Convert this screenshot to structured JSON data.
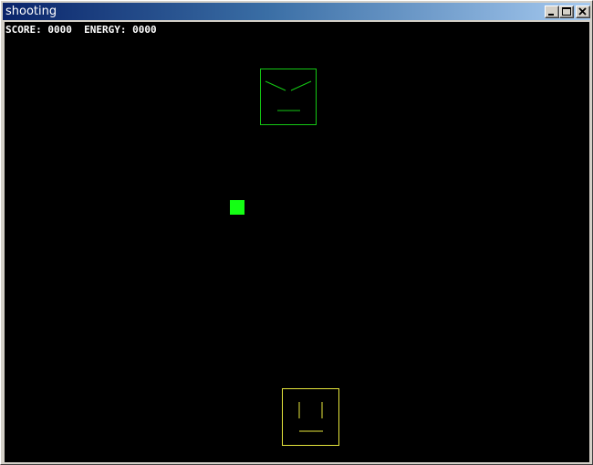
{
  "window": {
    "title": "shooting",
    "buttons": [
      "minimize",
      "maximize",
      "close"
    ]
  },
  "hud": {
    "score_label": "SCORE:",
    "score_value": "0000",
    "energy_label": "ENERGY:",
    "energy_value": "0000"
  },
  "game": {
    "enemy": {
      "expression": "angry",
      "color": "#14c814"
    },
    "player": {
      "expression": "neutral",
      "color": "#e6e63c"
    },
    "bullet": {
      "color": "#14ff14"
    },
    "background": "#000000"
  },
  "icons": {
    "minimize": "minimize-icon",
    "maximize": "maximize-icon",
    "close": "close-icon"
  }
}
